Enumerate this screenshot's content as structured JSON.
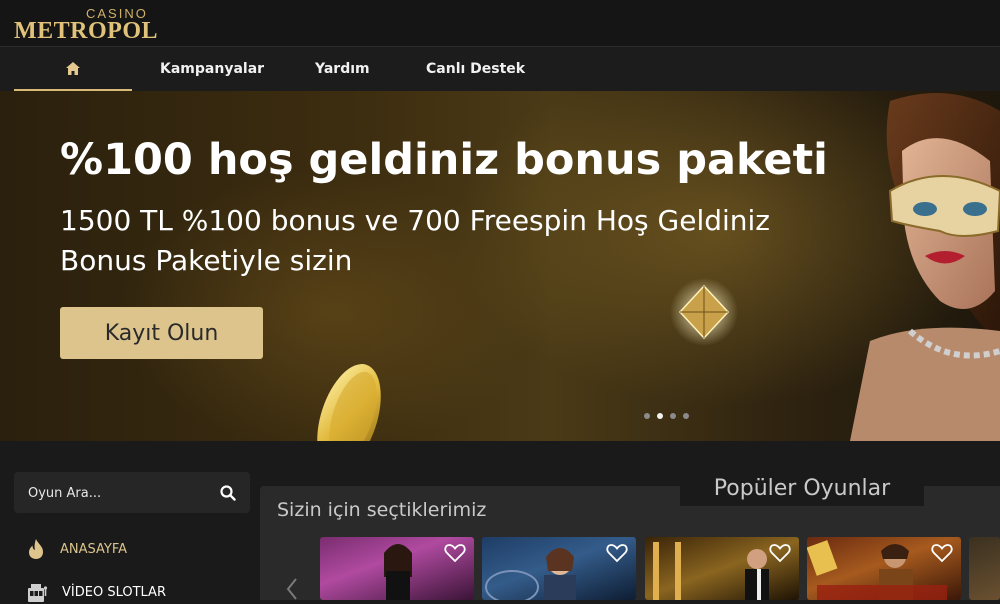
{
  "header": {
    "logo_small": "CASINO",
    "logo_big": "METROPOL"
  },
  "nav": {
    "home_icon": "home-icon",
    "items": [
      {
        "label": "Kampanyalar"
      },
      {
        "label": "Yardım"
      },
      {
        "label": "Canlı Destek"
      }
    ]
  },
  "hero": {
    "title": "%100 hoş geldiniz bonus paketi",
    "subtitle": "1500 TL %100 bonus ve 700 Freespin Hoş Geldiniz Bonus Paketiyle sizin",
    "cta_label": "Kayıt Olun",
    "slides_total": 4,
    "active_slide": 2
  },
  "search": {
    "placeholder": "Oyun Ara...",
    "icon": "search-icon"
  },
  "sidebar": {
    "items": [
      {
        "label": "ANASAYFA",
        "icon": "flame-icon",
        "active": true
      },
      {
        "label": "VİDEO SLOTLAR",
        "icon": "slot-machine-icon",
        "active": false
      }
    ]
  },
  "games": {
    "tab_label": "Popüler Oyunlar",
    "section_title": "Sizin için seçtiklerimiz",
    "prev_icon": "chevron-left-icon",
    "favorite_icon": "heart-icon"
  },
  "colors": {
    "accent": "#dcc48c",
    "header_bg": "#151515",
    "body_bg": "#1a1a1a",
    "panel_bg": "#2a2a2a"
  }
}
